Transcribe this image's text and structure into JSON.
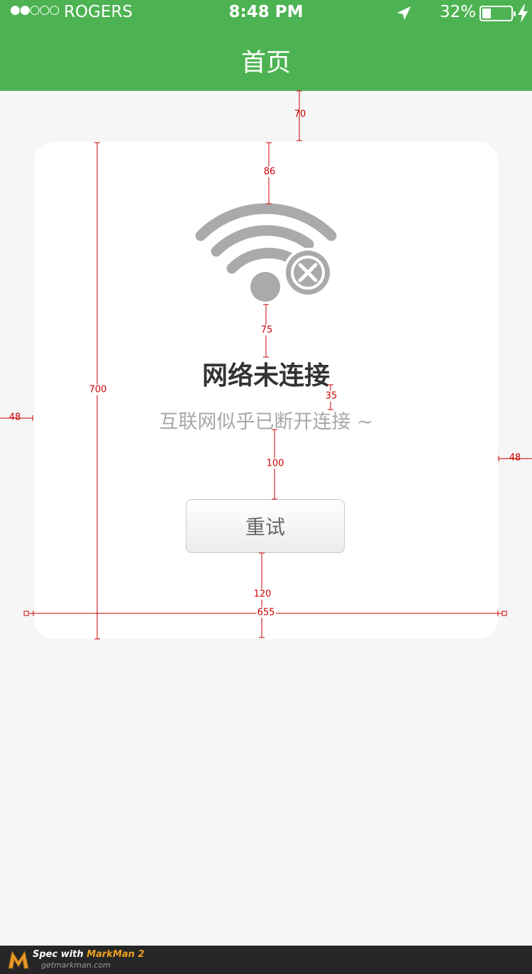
{
  "status_bar": {
    "signal": "●●○○○",
    "carrier": "ROGERS",
    "time": "8:48 PM",
    "battery_percent": "32%",
    "battery_level": 0.32,
    "icons": [
      "location-arrow-icon",
      "battery-icon",
      "charging-bolt-icon"
    ]
  },
  "nav": {
    "title": "首页"
  },
  "error": {
    "icon": "wifi-disconnected-icon",
    "title": "网络未连接",
    "subtitle": "互联网似乎已断开连接 ~",
    "retry_label": "重试"
  },
  "spec": {
    "top_gap": "70",
    "icon_gap": "86",
    "card_height": "700",
    "icon_title_gap": "75",
    "title_subtitle_gap": "35",
    "left_margin": "48",
    "right_margin": "48",
    "subtitle_button_gap": "100",
    "button_bottom_gap": "120",
    "card_width": "655"
  },
  "footer": {
    "title_prefix": "Spec with ",
    "title_brand": "MarkMan 2",
    "url": "getmarkman.com"
  },
  "colors": {
    "header": "#4db352",
    "background": "#f6f6f6",
    "card": "#ffffff",
    "icon_gray": "#aaaaaa",
    "spec_red": "#cc0000"
  }
}
